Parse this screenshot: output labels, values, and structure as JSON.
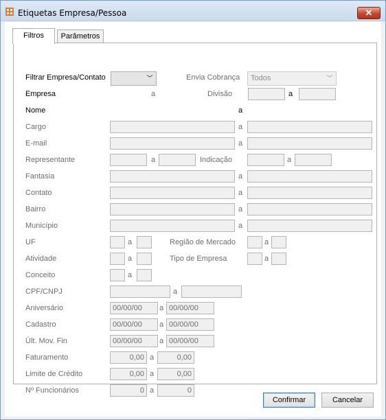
{
  "window": {
    "title": "Etiquetas Empresa/Pessoa",
    "close_label": "✕"
  },
  "tabs": [
    {
      "label": "Filtros"
    },
    {
      "label": "Parâmetros"
    }
  ],
  "filtros": {
    "filtrar_label": "Filtrar Empresa/Contato",
    "filtrar_value": "",
    "envia_cobranca_label": "Envia Cobrança",
    "envia_cobranca_value": "Todos",
    "empresa_label": "Empresa",
    "divisao_label": "Divisão",
    "nome_label": "Nome",
    "cargo_label": "Cargo",
    "email_label": "E-mail",
    "representante_label": "Representante",
    "indicacao_label": "Indicação",
    "fantasia_label": "Fantasia",
    "contato_label": "Contato",
    "bairro_label": "Bairro",
    "municipio_label": "Município",
    "uf_label": "UF",
    "regiao_label": "Região de Mercado",
    "atividade_label": "Atividade",
    "tipo_empresa_label": "Tipo de Empresa",
    "conceito_label": "Conceito",
    "cpf_label": "CPF/CNPJ",
    "aniversario_label": "Aniversário",
    "aniversario_from": "00/00/00",
    "aniversario_to": "00/00/00",
    "cadastro_label": "Cadastro",
    "cadastro_from": "00/00/00",
    "cadastro_to": "00/00/00",
    "ult_mov_label": "Últ. Mov. Fin",
    "ult_mov_from": "00/00/00",
    "ult_mov_to": "00/00/00",
    "faturamento_label": "Faturamento",
    "faturamento_from": "0,00",
    "faturamento_to": "0,00",
    "limite_label": "Limite de Crédito",
    "limite_from": "0,00",
    "limite_to": "0,00",
    "funcionarios_label": "Nº Funcionários",
    "funcionarios_from": "0",
    "funcionarios_to": "0",
    "range_sep": "a"
  },
  "buttons": {
    "confirmar": "Confirmar",
    "cancelar": "Cancelar"
  },
  "colors": {
    "accent": "#3c7fb1",
    "close": "#c7452d"
  }
}
